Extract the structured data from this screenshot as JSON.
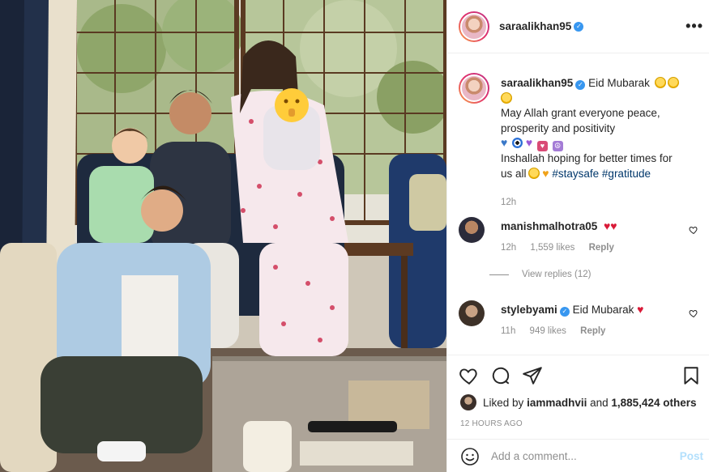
{
  "post": {
    "author": "saraalikhan95",
    "caption": {
      "greeting": "Eid Mubarak",
      "line1": "May Allah grant everyone peace,",
      "line2": "prosperity and positivity",
      "line3": "Inshallah hoping for better times for",
      "line4_prefix": "us all",
      "hashtag1": "#staysafe",
      "hashtag2": "#gratitude",
      "time": "12h"
    },
    "comments": [
      {
        "user": "manishmalhotra05",
        "time": "12h",
        "likes": "1,559 likes",
        "reply": "Reply",
        "view_replies": "View replies (12)"
      },
      {
        "user": "stylebyami",
        "text": "Eid Mubarak",
        "time": "11h",
        "likes": "949 likes",
        "reply": "Reply"
      }
    ],
    "liked_by": {
      "prefix": "Liked by",
      "user": "iammadhvii",
      "and": "and",
      "count": "1,885,424 others"
    },
    "timestamp": "12 HOURS AGO",
    "add_comment_placeholder": "Add a comment...",
    "post_label": "Post",
    "more_label": "•••"
  },
  "colors": {
    "verified": "#3897f0",
    "hashtag": "#00376b",
    "muted": "#8e8e8e",
    "post_button": "#b2dffc"
  },
  "icons": [
    "more-options-icon",
    "verified-icon",
    "heart-icon",
    "comment-icon",
    "share-icon",
    "save-icon",
    "emoji-icon",
    "small-heart-icon"
  ]
}
